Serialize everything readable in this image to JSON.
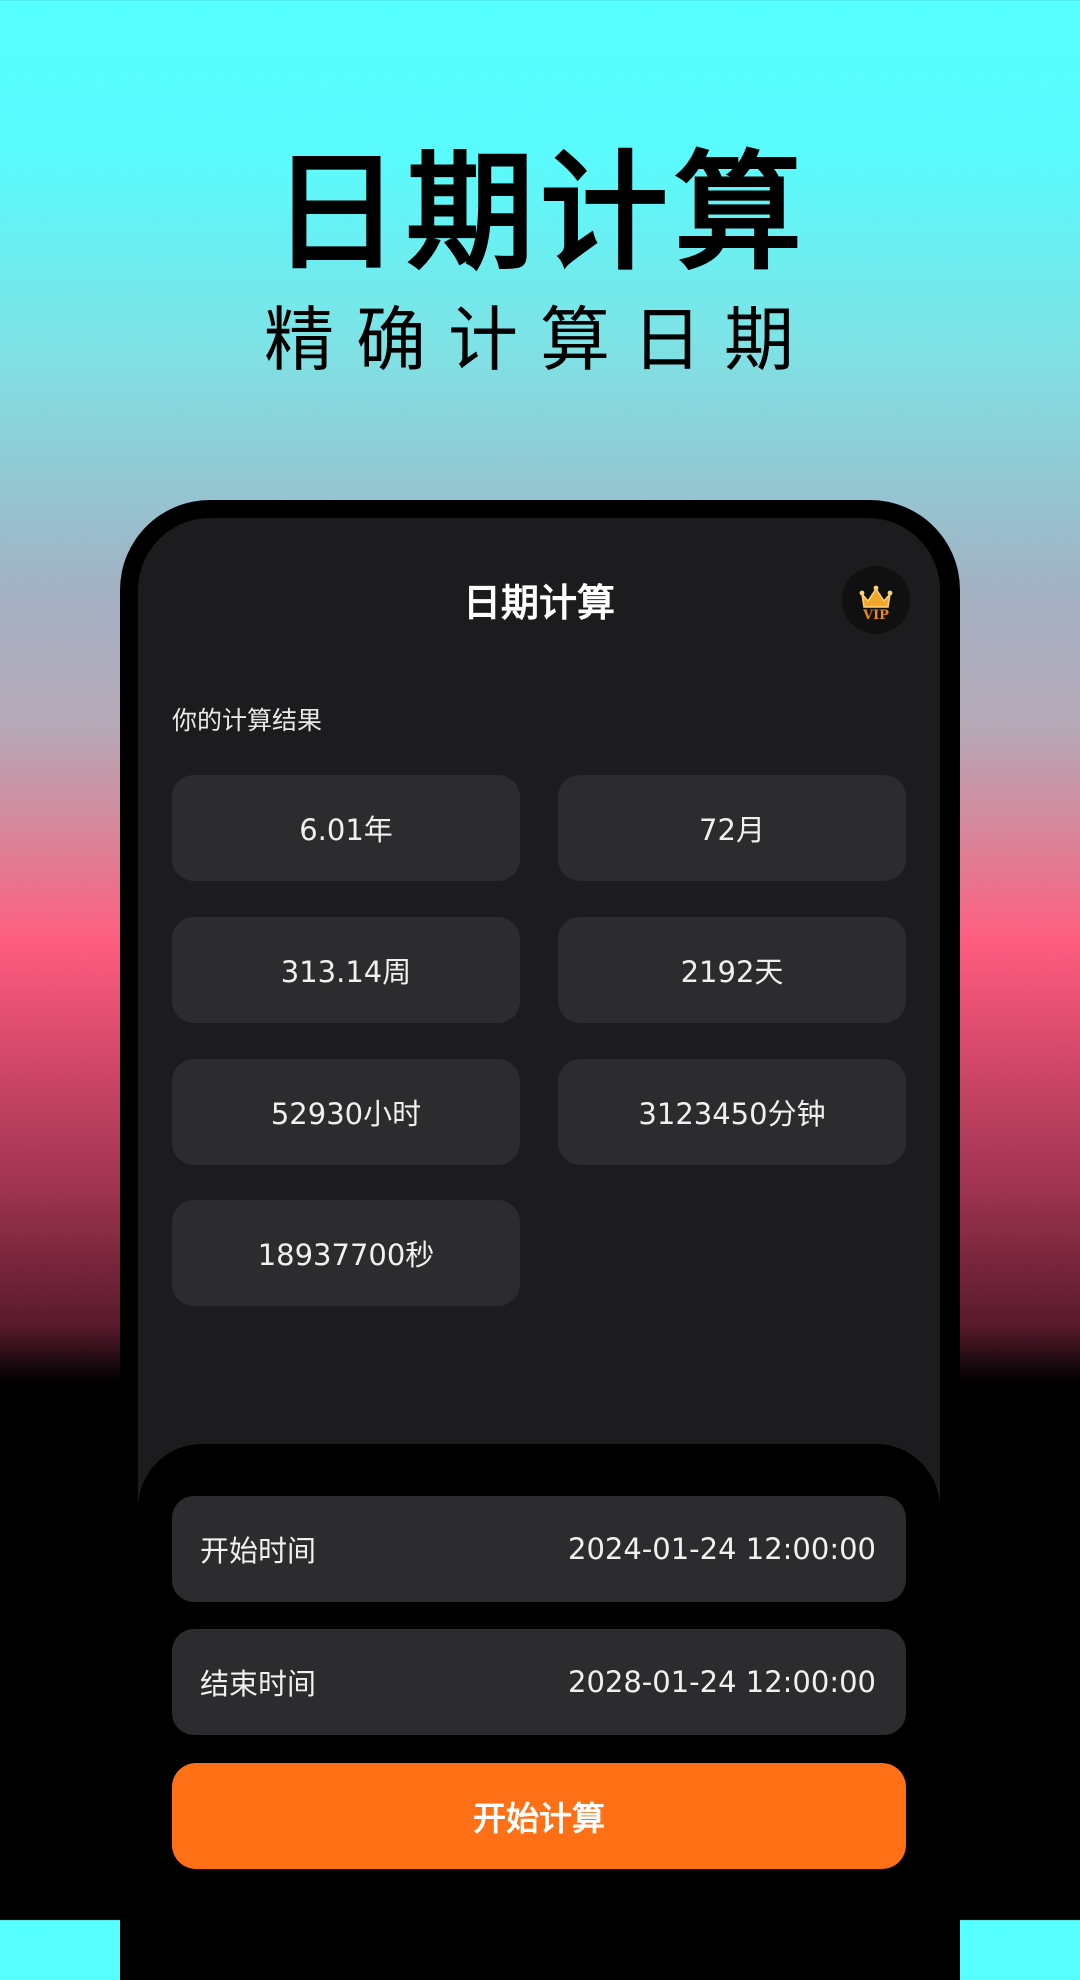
{
  "hero": {
    "title": "日期计算",
    "subtitle": "精确计算日期"
  },
  "app": {
    "title": "日期计算",
    "vip_badge": {
      "icon": "vip-crown-icon",
      "text": "VIP",
      "colors": {
        "gold": "#f4a62a",
        "dark": "#101010"
      }
    }
  },
  "results": {
    "label": "你的计算结果",
    "items": [
      {
        "value": "6.01年"
      },
      {
        "value": "72月"
      },
      {
        "value": "313.14周"
      },
      {
        "value": "2192天"
      },
      {
        "value": "52930小时"
      },
      {
        "value": "3123450分钟"
      },
      {
        "value": "18937700秒"
      }
    ]
  },
  "form": {
    "start": {
      "label": "开始时间",
      "value": "2024-01-24 12:00:00"
    },
    "end": {
      "label": "结束时间",
      "value": "2028-01-24 12:00:00"
    },
    "submit_label": "开始计算"
  },
  "colors": {
    "accent": "#ff6f15",
    "card": "#2c2c2e",
    "screen": "#1c1c1e"
  }
}
